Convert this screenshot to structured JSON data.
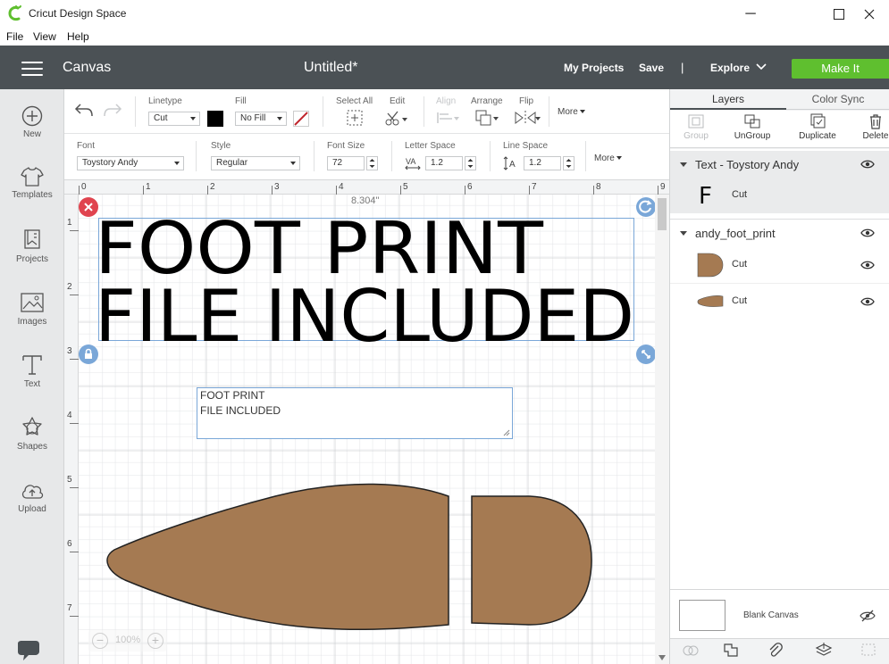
{
  "window": {
    "title": "Cricut Design Space",
    "minimize_glyph": "─",
    "maximize_glyph": "☐",
    "close_glyph": "✕"
  },
  "menu": {
    "items": [
      "File",
      "View",
      "Help"
    ]
  },
  "header": {
    "canvas_label": "Canvas",
    "document_title": "Untitled*",
    "my_projects": "My Projects",
    "save": "Save",
    "separator": "|",
    "explore": "Explore",
    "make_it": "Make It"
  },
  "sidebar": {
    "items": [
      {
        "label": "New",
        "icon": "plus-circle-icon"
      },
      {
        "label": "Templates",
        "icon": "shirt-icon"
      },
      {
        "label": "Projects",
        "icon": "projects-icon"
      },
      {
        "label": "Images",
        "icon": "image-icon"
      },
      {
        "label": "Text",
        "icon": "text-t-icon"
      },
      {
        "label": "Shapes",
        "icon": "shapes-icon"
      },
      {
        "label": "Upload",
        "icon": "cloud-upload-icon"
      }
    ]
  },
  "edit_toolbar": {
    "linetype_label": "Linetype",
    "linetype_value": "Cut",
    "fill_label": "Fill",
    "fill_value": "No Fill",
    "select_all_label": "Select All",
    "edit_label": "Edit",
    "align_label": "Align",
    "arrange_label": "Arrange",
    "flip_label": "Flip",
    "more_label": "More"
  },
  "text_toolbar": {
    "font_label": "Font",
    "font_value": "Toystory Andy",
    "style_label": "Style",
    "style_value": "Regular",
    "font_size_label": "Font Size",
    "font_size_value": "72",
    "letter_space_label": "Letter Space",
    "letter_space_value": "1.2",
    "line_space_label": "Line Space",
    "line_space_value": "1.2",
    "more_label": "More"
  },
  "canvas": {
    "ruler_top": [
      "0",
      "1",
      "2",
      "3",
      "4",
      "5",
      "6",
      "7",
      "8",
      "9"
    ],
    "ruler_left": [
      "1",
      "2",
      "3",
      "4",
      "5",
      "6",
      "7"
    ],
    "selection_width": "8.304\"",
    "headline_lines": [
      "FOOT PRINT",
      "FILE INCLUDED"
    ],
    "text_edit_lines": [
      "FOOT PRINT",
      "FILE INCLUDED"
    ],
    "zoom_value": "100%",
    "shape_color": "#a57a52"
  },
  "layers_panel": {
    "tabs": [
      "Layers",
      "Color Sync"
    ],
    "actions": [
      "Group",
      "UnGroup",
      "Duplicate",
      "Delete"
    ],
    "groups": [
      {
        "name": "Text - Toystory Andy",
        "items": [
          {
            "label": "Cut",
            "thumb_text": "F"
          }
        ]
      },
      {
        "name": "andy_foot_print",
        "items": [
          {
            "label": "Cut"
          },
          {
            "label": "Cut"
          }
        ]
      }
    ],
    "blank_canvas_label": "Blank Canvas"
  }
}
